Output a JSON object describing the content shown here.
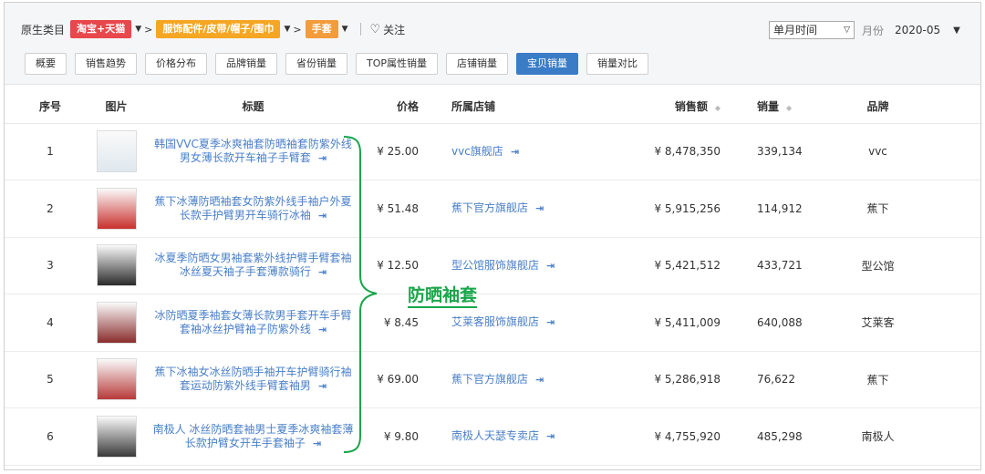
{
  "breadcrumb": {
    "label": "原生类目",
    "level1": "淘宝+天猫",
    "level2": "服饰配件/皮带/帽子/围巾",
    "level3": "手套",
    "follow": "关注"
  },
  "period": {
    "select_value": "单月时间",
    "month_label": "月份",
    "month_value": "2020-05"
  },
  "tabs": [
    {
      "label": "概要",
      "active": false
    },
    {
      "label": "销售趋势",
      "active": false
    },
    {
      "label": "价格分布",
      "active": false
    },
    {
      "label": "品牌销量",
      "active": false
    },
    {
      "label": "省份销量",
      "active": false
    },
    {
      "label": "TOP属性销量",
      "active": false
    },
    {
      "label": "店铺销量",
      "active": false
    },
    {
      "label": "宝贝销量",
      "active": true
    },
    {
      "label": "销量对比",
      "active": false
    }
  ],
  "table": {
    "headers": {
      "no": "序号",
      "image": "图片",
      "title": "标题",
      "price": "价格",
      "shop": "所属店铺",
      "sales": "销售额",
      "qty": "销量",
      "brand": "品牌"
    },
    "rows": [
      {
        "no": "1",
        "title_line1": "韩国VVC夏季冰爽袖套防晒袖套防紫外线",
        "title_line2": "男女薄长款开车袖子手臂套",
        "price": "¥ 25.00",
        "shop": "vvc旗舰店",
        "sales": "¥ 8,478,350",
        "qty": "339,134",
        "brand": "vvc",
        "thumb": "#dfe8ee"
      },
      {
        "no": "2",
        "title_line1": "蕉下冰薄防晒袖套女防紫外线手袖户外夏",
        "title_line2": "长款手护臂男开车骑行冰袖",
        "price": "¥ 51.48",
        "shop": "蕉下官方旗舰店",
        "sales": "¥ 5,915,256",
        "qty": "114,912",
        "brand": "蕉下",
        "thumb": "#c9302c"
      },
      {
        "no": "3",
        "title_line1": "冰夏季防晒女男袖套紫外线护臂手臂套袖",
        "title_line2": "冰丝夏天袖子手套薄款骑行",
        "price": "¥ 12.50",
        "shop": "型公馆服饰旗舰店",
        "sales": "¥ 5,421,512",
        "qty": "433,721",
        "brand": "型公馆",
        "thumb": "#2b2b2b"
      },
      {
        "no": "4",
        "title_line1": "冰防晒夏季袖套女薄长款男手套开车手臂",
        "title_line2": "套袖冰丝护臂袖子防紫外线",
        "price": "¥ 8.45",
        "shop": "艾莱客服饰旗舰店",
        "sales": "¥ 5,411,009",
        "qty": "640,088",
        "brand": "艾莱客",
        "thumb": "#8a2c2c"
      },
      {
        "no": "5",
        "title_line1": "蕉下冰袖女冰丝防晒手袖开车护臂骑行袖",
        "title_line2": "套运动防紫外线手臂套袖男",
        "price": "¥ 69.00",
        "shop": "蕉下官方旗舰店",
        "sales": "¥ 5,286,918",
        "qty": "76,622",
        "brand": "蕉下",
        "thumb": "#b83a3a"
      },
      {
        "no": "6",
        "title_line1": "南极人 冰丝防晒套袖男士夏季冰爽袖套薄",
        "title_line2": "长款护臂女开车手套袖子",
        "price": "¥ 9.80",
        "shop": "南极人天瑟专卖店",
        "sales": "¥ 4,755,920",
        "qty": "485,298",
        "brand": "南极人",
        "thumb": "#3a3a3a"
      }
    ]
  },
  "annotation": {
    "text": "防晒袖套",
    "color": "#1aa64b"
  },
  "colors": {
    "accent": "#3a7cc5",
    "link": "#4a7fc8",
    "tag_red": "#e8474c",
    "tag_orange": "#f5a623"
  }
}
